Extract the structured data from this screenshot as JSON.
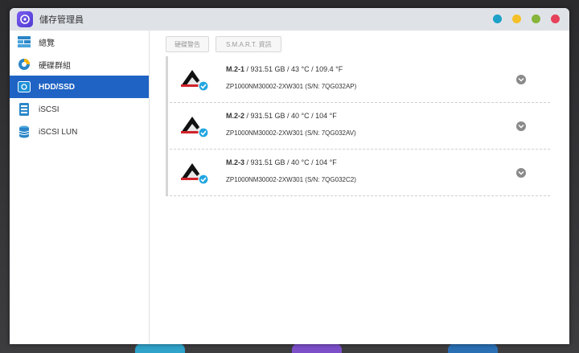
{
  "window": {
    "title": "儲存管理員"
  },
  "colors": {
    "accent": "#1f63c4",
    "dot_teal": "#1ea1c8",
    "dot_yellow": "#f4c02a",
    "dot_green": "#86b53a",
    "dot_red": "#e6415a"
  },
  "sidebar": {
    "items": [
      {
        "label": "總覽",
        "icon": "overview-icon",
        "active": false
      },
      {
        "label": "硬碟群組",
        "icon": "pie-chart-icon",
        "active": false
      },
      {
        "label": "HDD/SSD",
        "icon": "hdd-icon",
        "active": true
      },
      {
        "label": "iSCSI",
        "icon": "iscsi-icon",
        "active": false
      },
      {
        "label": "iSCSI LUN",
        "icon": "database-icon",
        "active": false
      }
    ]
  },
  "toolbar": {
    "health_label": "硬碟警告",
    "smart_label": "S.M.A.R.T. 資訊"
  },
  "disks": [
    {
      "name": "M.2-1",
      "details": " / 931.51 GB / 43 °C / 109.4 °F",
      "model": "ZP1000NM30002-2XW301 (S/N: 7QG032AP)"
    },
    {
      "name": "M.2-2",
      "details": " / 931.51 GB / 40 °C / 104 °F",
      "model": "ZP1000NM30002-2XW301 (S/N: 7QG032AV)"
    },
    {
      "name": "M.2-3",
      "details": " / 931.51 GB / 40 °C / 104 °F",
      "model": "ZP1000NM30002-2XW301 (S/N: 7QG032C2)"
    }
  ]
}
